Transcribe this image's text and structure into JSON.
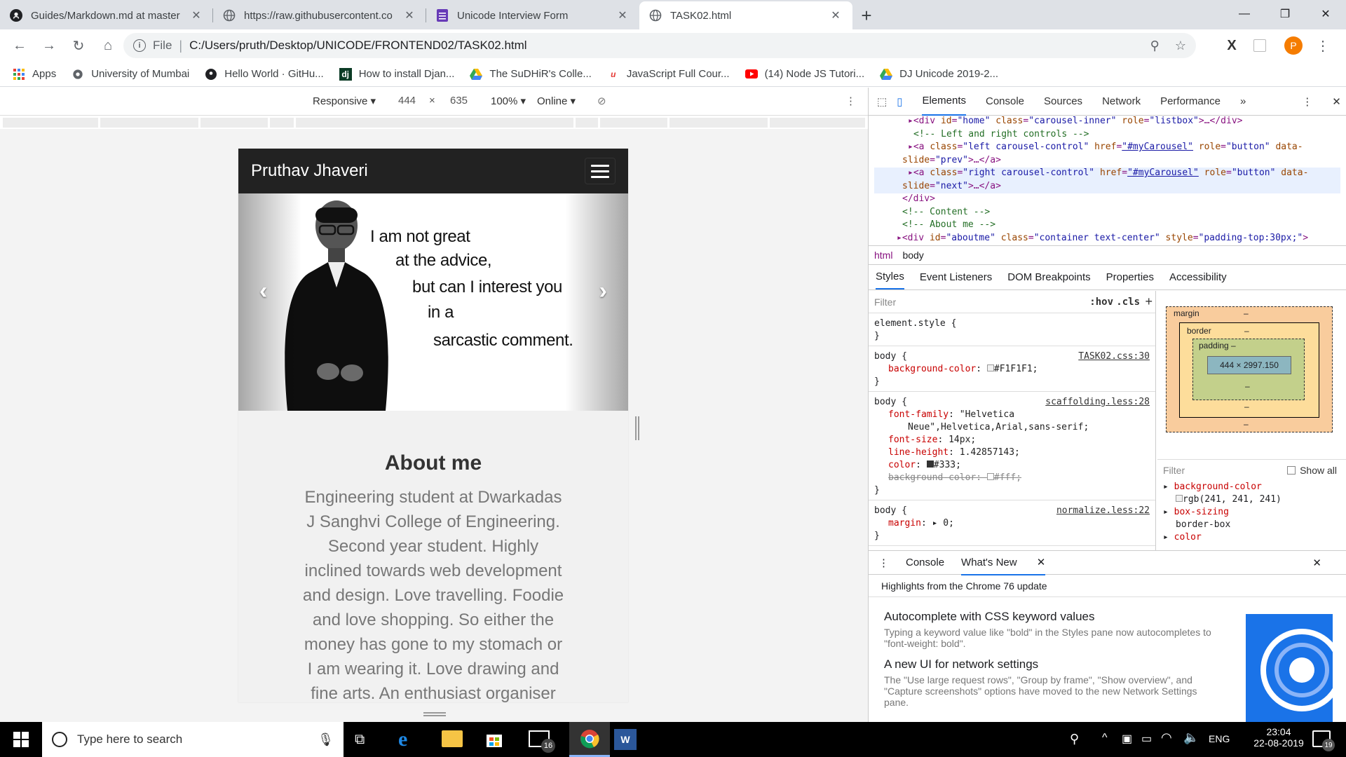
{
  "tabs": [
    {
      "title": "Guides/Markdown.md at master",
      "icon": "github-icon"
    },
    {
      "title": "https://raw.githubusercontent.co",
      "icon": "globe-icon"
    },
    {
      "title": "Unicode Interview Form",
      "icon": "form-icon"
    },
    {
      "title": "TASK02.html",
      "icon": "globe-icon",
      "active": true
    }
  ],
  "omnibox": {
    "scheme": "File",
    "url": "C:/Users/pruth/Desktop/UNICODE/FRONTEND02/TASK02.html"
  },
  "profile_initial": "P",
  "bookmarks": [
    {
      "label": "Apps",
      "icon": "apps-icon"
    },
    {
      "label": "University of Mumbai",
      "icon": "globe-icon"
    },
    {
      "label": "Hello World · GitHu...",
      "icon": "github-icon"
    },
    {
      "label": "How to install Djan...",
      "icon": "django-icon"
    },
    {
      "label": "The SuDHiR's Colle...",
      "icon": "drive-icon"
    },
    {
      "label": "JavaScript Full Cour...",
      "icon": "udemy-icon"
    },
    {
      "label": "(14) Node JS Tutori...",
      "icon": "youtube-icon"
    },
    {
      "label": "DJ Unicode 2019-2...",
      "icon": "drive-icon"
    }
  ],
  "device_toolbar": {
    "mode": "Responsive",
    "width": "444",
    "height": "635",
    "zoom": "100%",
    "throttle": "Online"
  },
  "site": {
    "brand": "Pruthav Jhaveri",
    "quote": [
      "I am not great",
      "at the advice,",
      "but can I interest you",
      "in a",
      "sarcastic comment."
    ],
    "about_title": "About me",
    "about_lines": [
      "Engineering student at Dwarkadas",
      "J Sanghvi College of Engineering.",
      "Second year student. Highly",
      "inclined towards web development",
      "and design. Love travelling. Foodie",
      "and love shopping. So either the",
      "money has gone to my stomach or",
      "I am wearing it. Love drawing and",
      "fine arts. An enthusiast organiser"
    ]
  },
  "devtools": {
    "tabs": [
      "Elements",
      "Console",
      "Sources",
      "Network",
      "Performance"
    ],
    "breadcrumbs": [
      "html",
      "body"
    ],
    "subtabs": [
      "Styles",
      "Event Listeners",
      "DOM Breakpoints",
      "Properties",
      "Accessibility"
    ],
    "styles_filter": "Filter",
    "hov": ":hov",
    "cls": ".cls",
    "box_content": "444 × 2997.150",
    "computed_filter": "Filter",
    "show_all": "Show all",
    "drawer_tabs": [
      "Console",
      "What's New"
    ],
    "whats_new_header": "Highlights from the Chrome 76 update",
    "whats_new": [
      {
        "title": "Autocomplete with CSS keyword values",
        "desc": "Typing a keyword value like \"bold\" in the Styles pane now autocompletes to \"font-weight: bold\"."
      },
      {
        "title": "A new UI for network settings",
        "desc": "The \"Use large request rows\", \"Group by frame\", \"Show overview\", and \"Capture screenshots\" options have moved to the new Network Settings pane."
      }
    ]
  },
  "taskbar": {
    "search_placeholder": "Type here to search",
    "mail_badge": "16",
    "lang": "ENG",
    "time": "23:04",
    "date": "22-08-2019",
    "notif_count": "19"
  }
}
